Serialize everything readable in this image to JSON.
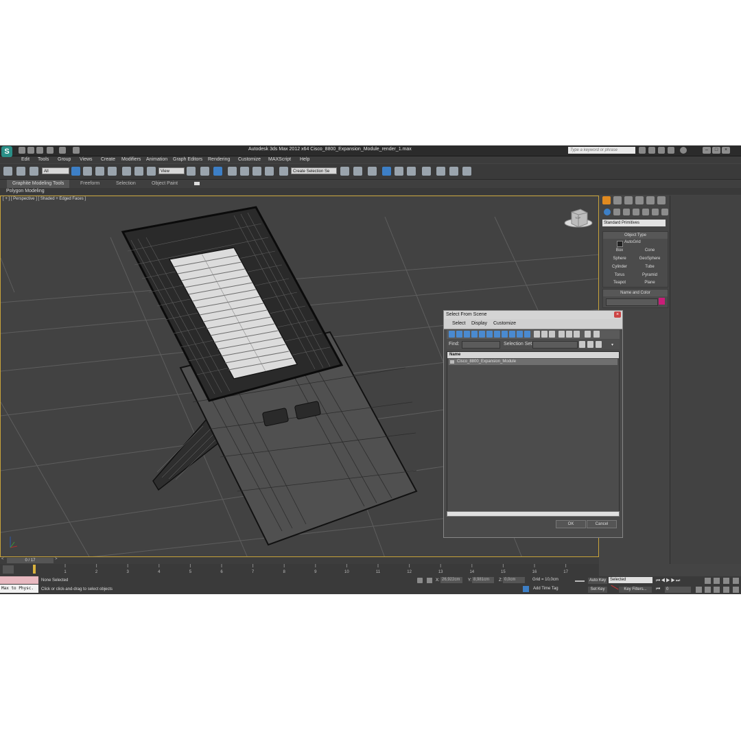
{
  "window": {
    "title": "Autodesk 3ds Max  2012 x64     Cisco_8800_Expansion_Module_render_1.max",
    "search_placeholder": "Type a keyword or phrase"
  },
  "menu": [
    "Edit",
    "Tools",
    "Group",
    "Views",
    "Create",
    "Modifiers",
    "Animation",
    "Graph Editors",
    "Rendering",
    "Customize",
    "MAXScript",
    "Help"
  ],
  "toolbar": {
    "filter_value": "All",
    "refcoord_value": "View",
    "selection_set_value": "Create Selection Se"
  },
  "ribbon": {
    "tabs": [
      "Graphite Modeling Tools",
      "Freeform",
      "Selection",
      "Object Paint"
    ],
    "sub_label": "Polygon Modeling"
  },
  "viewport": {
    "label": "[ + ] [ Perspective ] [ Shaded + Edged Faces ]",
    "viewcube_label": "TOP"
  },
  "command_panel": {
    "category_value": "Standard Primitives",
    "object_type_header": "Object Type",
    "autogrid_label": "AutoGrid",
    "primitives": [
      "Box",
      "Cone",
      "Sphere",
      "GeoSphere",
      "Cylinder",
      "Tube",
      "Torus",
      "Pyramid",
      "Teapot",
      "Plane"
    ],
    "name_color_header": "Name and Color",
    "swatch_color": "#c81e78"
  },
  "dialog": {
    "title": "Select From Scene",
    "menu": [
      "Select",
      "Display",
      "Customize"
    ],
    "find_label": "Find:",
    "selection_set_label": "Selection Set:",
    "column_name": "Name",
    "rows": [
      "Cisco_8800_Expansion_Module"
    ],
    "ok_label": "OK",
    "cancel_label": "Cancel"
  },
  "timeline": {
    "frame_counter": "0 / 17",
    "ticks": [
      "1",
      "2",
      "3",
      "4",
      "5",
      "6",
      "7",
      "8",
      "9",
      "10",
      "11",
      "12",
      "13",
      "14",
      "15",
      "16",
      "17"
    ]
  },
  "status": {
    "maxscript_label": "Max to Physc.",
    "selection_status": "None Selected",
    "prompt": "Click or click-and-drag to select objects",
    "x_label": "X:",
    "x_value": "26,922cm",
    "y_label": "Y:",
    "y_value": "8,981cm",
    "z_label": "Z:",
    "z_value": "0,0cm",
    "grid": "Grid = 10,0cm",
    "add_time_tag": "Add Time Tag",
    "auto_key": "Auto Key",
    "auto_key_value": "Selected",
    "set_key": "Set Key",
    "key_filters": "Key Filters...",
    "frame_value": "0"
  }
}
